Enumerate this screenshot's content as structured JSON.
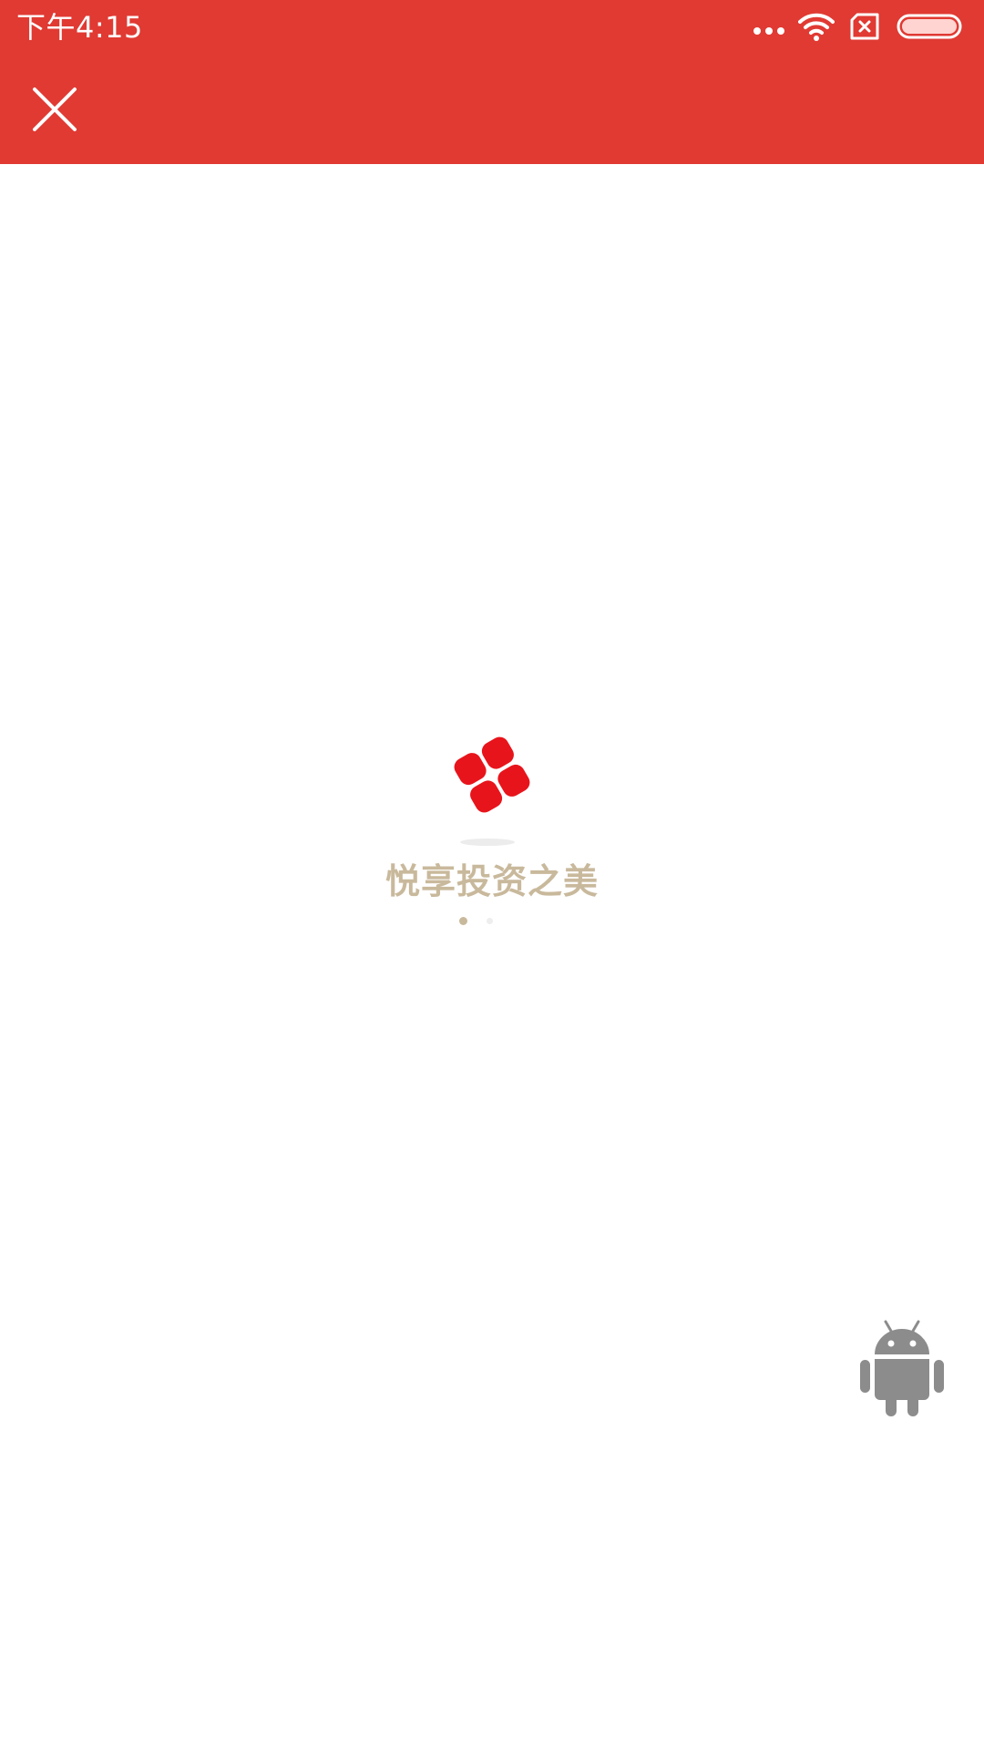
{
  "status_bar": {
    "time": "下午4:15",
    "icons": [
      "more-dots-icon",
      "wifi-icon",
      "sim-off-icon",
      "battery-icon"
    ]
  },
  "toolbar": {
    "close_icon": "close-icon"
  },
  "loader": {
    "logo_icon": "brand-logo-icon",
    "slogan": "悦享投资之美",
    "page_indicator": {
      "active": 1,
      "total": 2
    }
  },
  "floating": {
    "icon": "android-icon"
  },
  "colors": {
    "header_bg": "#e03a33",
    "logo_red": "#e8141b",
    "slogan": "#c9b99c",
    "android_gray": "#8c8c8c"
  }
}
